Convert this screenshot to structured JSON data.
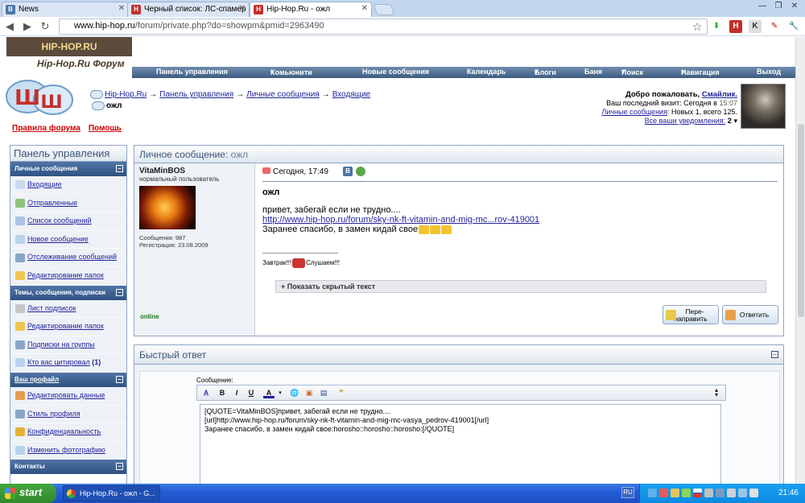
{
  "browser": {
    "tabs": [
      {
        "label": "News",
        "active": false,
        "icon": "vk-icon"
      },
      {
        "label": "Черный список: ЛС-спамер",
        "active": false,
        "icon": "hiphop-icon"
      },
      {
        "label": "Hip-Hop.Ru - ожл",
        "active": true,
        "icon": "hiphop-icon"
      }
    ],
    "url_host": "www.hip-hop.ru",
    "url_path": "/forum/private.php?do=showpm&pmid=2963490"
  },
  "site": {
    "logo_text": "HIP-HOP.RU",
    "forum_title": "Hip-Hop.Ru Форум"
  },
  "navbar": {
    "items": [
      "Панель управления",
      "Комьюнити",
      "Новые сообщения",
      "Календарь",
      "Блоги",
      "Баня",
      "Поиск",
      "Навигация",
      "Выход"
    ]
  },
  "breadcrumb": {
    "items": [
      "Hip-Hop.Ru",
      "Панель управления",
      "Личные сообщения",
      "Входящие"
    ],
    "separator": "→",
    "current": "ожл"
  },
  "welcome": {
    "greeting": "Добро пожаловать,",
    "username": "Смайлик.",
    "last_visit": "Ваш последний визит: Сегодня в",
    "last_visit_time": "15:07",
    "pm_link": "Личные сообщения",
    "pm_stats": ": Новых 1, всего 125.",
    "notifications_link": "Все ваши уведомления:",
    "notifications_count": "2"
  },
  "rules": {
    "rules_link": "Правила форума",
    "help_link": "Помощь"
  },
  "sidebar": {
    "title": "Панель управления",
    "sections": [
      {
        "title": "Личные сообщения",
        "items": [
          "Входящие",
          "Отправленные",
          "Список сообщений",
          "Новое сообщение",
          "Отслеживание сообщений",
          "Редактирование папок"
        ]
      },
      {
        "title": "Темы, сообщения, подписки",
        "items": [
          "Лист подписок",
          "Редактирование папок",
          "Подписки на группы",
          "Кто вас цитировал"
        ],
        "badge": "(1)"
      },
      {
        "title": "Ваш профайл",
        "items": [
          "Редактировать данные",
          "Стиль профиля",
          "Конфиденциальность",
          "Изменить фотографию"
        ]
      },
      {
        "title": "Контакты",
        "items": []
      }
    ]
  },
  "pm": {
    "box_title": "Личное сообщение:",
    "box_subject": "ожл",
    "author": "VitaMinBOS",
    "author_title": "нормальный пользователь",
    "posts": "Сообщения: 987",
    "registered": "Регистрация: 23.08.2009",
    "status": "online",
    "date": "Сегодня, 17:49",
    "title": "ожл",
    "line1": "привет, забегай если не трудно....",
    "link": "http://www.hip-hop.ru/forum/sky-nk-ft-vitamin-and-mig-mc...rov-419001",
    "line3": "Заранее спасибо, в замен кидай свое",
    "sig_before": "Завтрак!!!",
    "sig_after": "Слушаем!!!",
    "spoiler": "Показать скрытый текст",
    "forward_btn": "Пере-\nнаправить",
    "reply_btn": "Ответить"
  },
  "quick_reply": {
    "title": "Быстрый ответ",
    "message_label": "Сообщение:",
    "toolbar": [
      "B",
      "I",
      "U",
      "A"
    ],
    "text": "[QUOTE=VitaMinBOS]привет, забегай если не трудно....\n[url]http://www.hip-hop.ru/forum/sky-nk-ft-vitamin-and-mig-mc-vasya_pedrov-419001[/url]\nЗаранее спасибо, в замен кидай свое:horosho::horosho::horosho:[/QUOTE]"
  },
  "taskbar": {
    "start": "start",
    "window": "Hip-Hop.Ru - ожл - G...",
    "lang": "RU",
    "clock": "21:46"
  }
}
